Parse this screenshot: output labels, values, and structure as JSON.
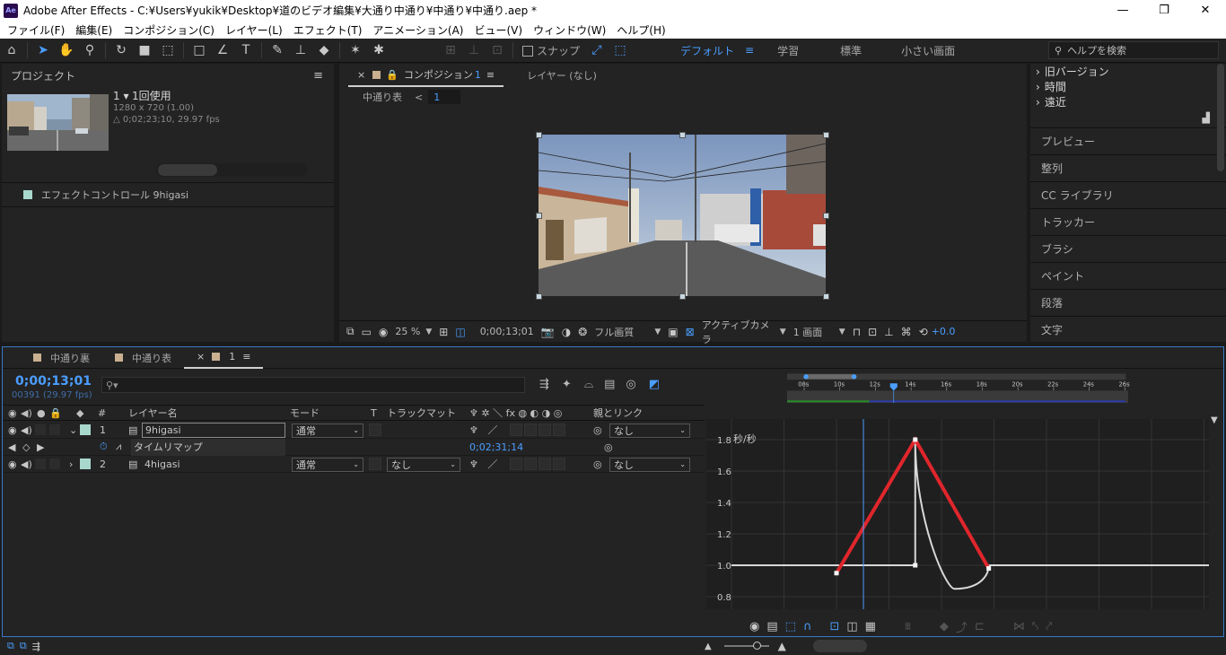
{
  "window": {
    "app_icon": "Ae",
    "title": "Adobe After Effects - C:¥Users¥yukik¥Desktop¥道のビデオ編集¥大通り中通り¥中通り¥中通り.aep *",
    "minimize": "—",
    "maximize": "❐",
    "close": "✕"
  },
  "menu": [
    "ファイル(F)",
    "編集(E)",
    "コンポジション(C)",
    "レイヤー(L)",
    "エフェクト(T)",
    "アニメーション(A)",
    "ビュー(V)",
    "ウィンドウ(W)",
    "ヘルプ(H)"
  ],
  "toolbar": {
    "snap_label": "スナップ",
    "workspaces": [
      "デフォルト",
      "学習",
      "標準",
      "小さい画面"
    ],
    "workspace_menu": "≡",
    "more": "»",
    "help_placeholder": "ヘルプを検索"
  },
  "project": {
    "title": "プロジェクト",
    "menu": "≡",
    "item_name": "1 ▾",
    "item_usage": "1回使用",
    "item_size": "1280 x 720 (1.00)",
    "item_duration": "△ 0;02;23;10, 29.97 fps",
    "effect_controls": "エフェクトコントロール 9higasi",
    "swatch_color": "#a8d8cc"
  },
  "composition": {
    "close": "×",
    "tab_label": "コンポジション",
    "tab_num": "1",
    "tab_menu": "≡",
    "layer_tab": "レイヤー (なし)",
    "breadcrumb": "中通り表",
    "breadcrumb_arrow": "<",
    "breadcrumb_current": "1",
    "zoom": "25 %",
    "timecode": "0;00;13;01",
    "resolution": "フル画質",
    "camera": "アクティブカメラ",
    "views": "1 画面",
    "exposure": "+0.0"
  },
  "right_panel": {
    "tree": [
      "旧バージョン",
      "時間",
      "遠近"
    ],
    "items": [
      "プレビュー",
      "整列",
      "CC ライブラリ",
      "トラッカー",
      "ブラシ",
      "ペイント",
      "段落",
      "文字"
    ]
  },
  "timeline": {
    "tabs": [
      {
        "label": "中通り裏",
        "color": "#c8b090"
      },
      {
        "label": "中通り表",
        "color": "#c8b090"
      },
      {
        "label": "1",
        "color": "#c8b090"
      }
    ],
    "close": "×",
    "tab_menu": "≡",
    "timecode": "0;00;13;01",
    "fps": "00391 (29.97 fps)",
    "search_placeholder": "",
    "columns": {
      "num": "#",
      "layer_name": "レイヤー名",
      "mode": "モード",
      "t": "T",
      "track_matte": "トラックマット",
      "parent": "親とリンク"
    },
    "layers": [
      {
        "num": "1",
        "name": "9higasi",
        "mode": "通常",
        "matte": "",
        "parent": "なし",
        "color": "#a8d8cc"
      },
      {
        "num": "2",
        "name": "4higasi",
        "mode": "通常",
        "matte": "なし",
        "parent": "なし",
        "color": "#a8d8cc"
      }
    ],
    "time_remap": {
      "label": "タイムリマップ",
      "value": "0;02;31;14"
    },
    "ruler_labels": [
      "08s",
      "10s",
      "12s",
      "14s",
      "16s",
      "18s",
      "20s",
      "22s",
      "24s",
      "26s"
    ],
    "graph": {
      "unit": "秒/秒",
      "y_ticks": [
        "1.8",
        "1.6",
        "1.4",
        "1.2",
        "1.0",
        "0.8"
      ]
    }
  },
  "chart_data": {
    "type": "line",
    "title": "",
    "ylabel": "秒/秒",
    "xlabel": "",
    "x_ticks": [
      "08s",
      "10s",
      "12s",
      "14s",
      "16s",
      "18s",
      "20s",
      "22s",
      "24s",
      "26s"
    ],
    "y_ticks": [
      1.8,
      1.6,
      1.4,
      1.2,
      1.0,
      0.8
    ],
    "series": [
      {
        "color": "#e0262c",
        "x": [
          12.0,
          15.0,
          17.8
        ],
        "y": [
          0.95,
          1.8,
          0.98
        ]
      },
      {
        "color": "#d8d8d8",
        "x": [
          8.0,
          12.0,
          15.0,
          15.0,
          16.5,
          17.8,
          26.5
        ],
        "y": [
          1.0,
          1.0,
          1.0,
          1.8,
          0.85,
          1.0,
          1.0
        ]
      }
    ],
    "grid": true
  }
}
